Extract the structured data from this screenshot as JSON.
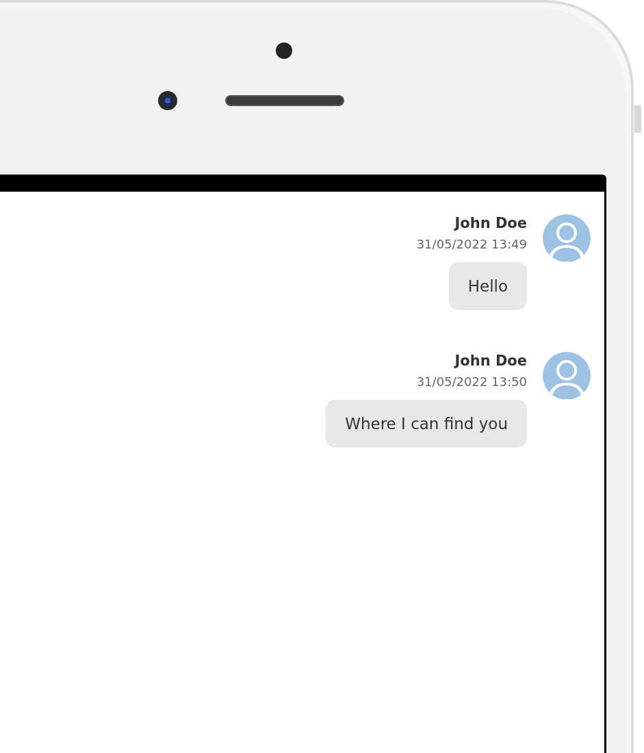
{
  "messages": [
    {
      "author": "John Doe",
      "timestamp": "31/05/2022 13:49",
      "text": "Hello"
    },
    {
      "author": "John Doe",
      "timestamp": "31/05/2022 13:50",
      "text": "Where I can find you"
    }
  ]
}
